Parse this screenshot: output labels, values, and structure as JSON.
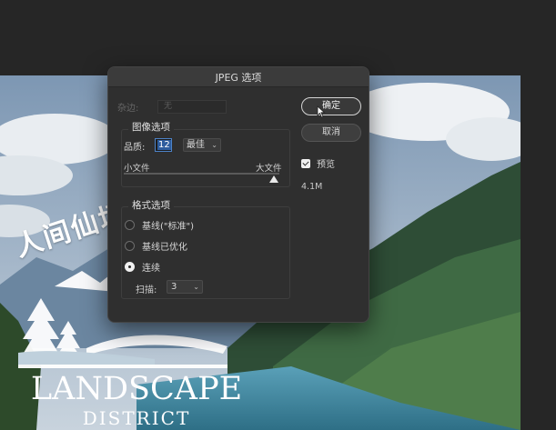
{
  "canvas": {
    "overlay_title": "人间仙境",
    "brand_title": "LANDSCAPE",
    "brand_subtitle": "DISTRICT"
  },
  "dialog": {
    "title": "JPEG 选项",
    "matte": {
      "label": "杂边:",
      "value": "无"
    },
    "image_options": {
      "title": "图像选项",
      "quality_label": "品质:",
      "quality_value": "12",
      "quality_preset": "最佳",
      "slider_min_label": "小文件",
      "slider_max_label": "大文件",
      "slider_value_fraction": 1.0
    },
    "format_options": {
      "title": "格式选项",
      "radios": [
        {
          "label": "基线(\"标准\")",
          "checked": false
        },
        {
          "label": "基线已优化",
          "checked": false
        },
        {
          "label": "连续",
          "checked": true
        }
      ],
      "scan_label": "扫描:",
      "scan_value": "3"
    },
    "buttons": {
      "ok": "确定",
      "cancel": "取消"
    },
    "preview": {
      "label": "预览",
      "checked": true
    },
    "file_size": "4.1M"
  },
  "icons": {
    "chevron": "chevron-down-icon",
    "cursor": "mouse-cursor-icon"
  }
}
